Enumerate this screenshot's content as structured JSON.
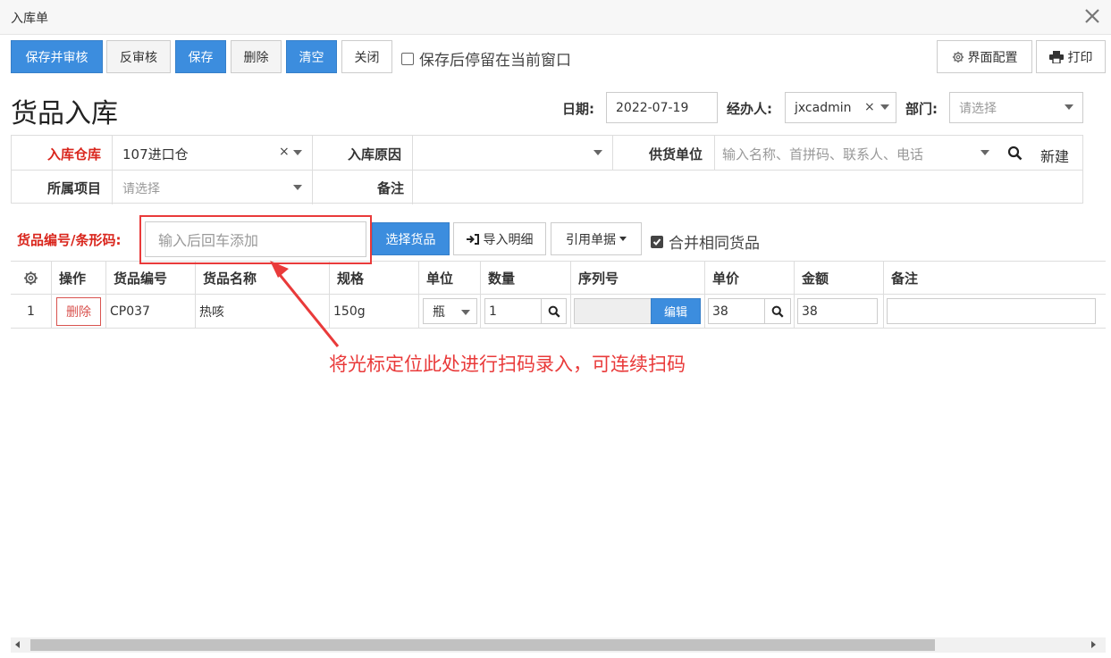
{
  "window": {
    "title": "入库单"
  },
  "toolbar": {
    "save_audit": "保存并审核",
    "unaudit": "反审核",
    "save": "保存",
    "delete": "删除",
    "clear": "清空",
    "close": "关闭",
    "stay_label": "保存后停留在当前窗口",
    "ui_config": "界面配置",
    "print": "打印"
  },
  "header": {
    "page_title": "货品入库",
    "date_label": "日期:",
    "date_value": "2022-07-19",
    "handler_label": "经办人:",
    "handler_value": "jxcadmin",
    "dept_label": "部门:",
    "dept_placeholder": "请选择"
  },
  "form": {
    "warehouse_label": "入库仓库",
    "warehouse_value": "107进口仓",
    "reason_label": "入库原因",
    "supplier_label": "供货单位",
    "supplier_placeholder": "输入名称、首拼码、联系人、电话",
    "new_label": "新建",
    "project_label": "所属项目",
    "project_placeholder": "请选择",
    "note_label": "备注"
  },
  "scan": {
    "label": "货品编号/条形码:",
    "placeholder": "输入后回车添加",
    "select_btn": "选择货品",
    "import_btn": "导入明细",
    "ref_btn": "引用单据",
    "merge_label": "合并相同货品"
  },
  "table": {
    "headers": [
      "操作",
      "货品编号",
      "货品名称",
      "规格",
      "单位",
      "数量",
      "序列号",
      "单价",
      "金额",
      "备注"
    ],
    "rows": [
      {
        "index": "1",
        "action": "删除",
        "code": "CP037",
        "name": "热咳",
        "spec": "150g",
        "unit": "瓶",
        "qty": "1",
        "serial_btn": "编辑",
        "price": "38",
        "amount": "38",
        "note": ""
      }
    ]
  },
  "annotation": {
    "text": "将光标定位此处进行扫码录入，可连续扫码"
  },
  "colors": {
    "primary": "#3c8dde",
    "annotation": "#e93a3a",
    "required_label": "#d9251c"
  }
}
